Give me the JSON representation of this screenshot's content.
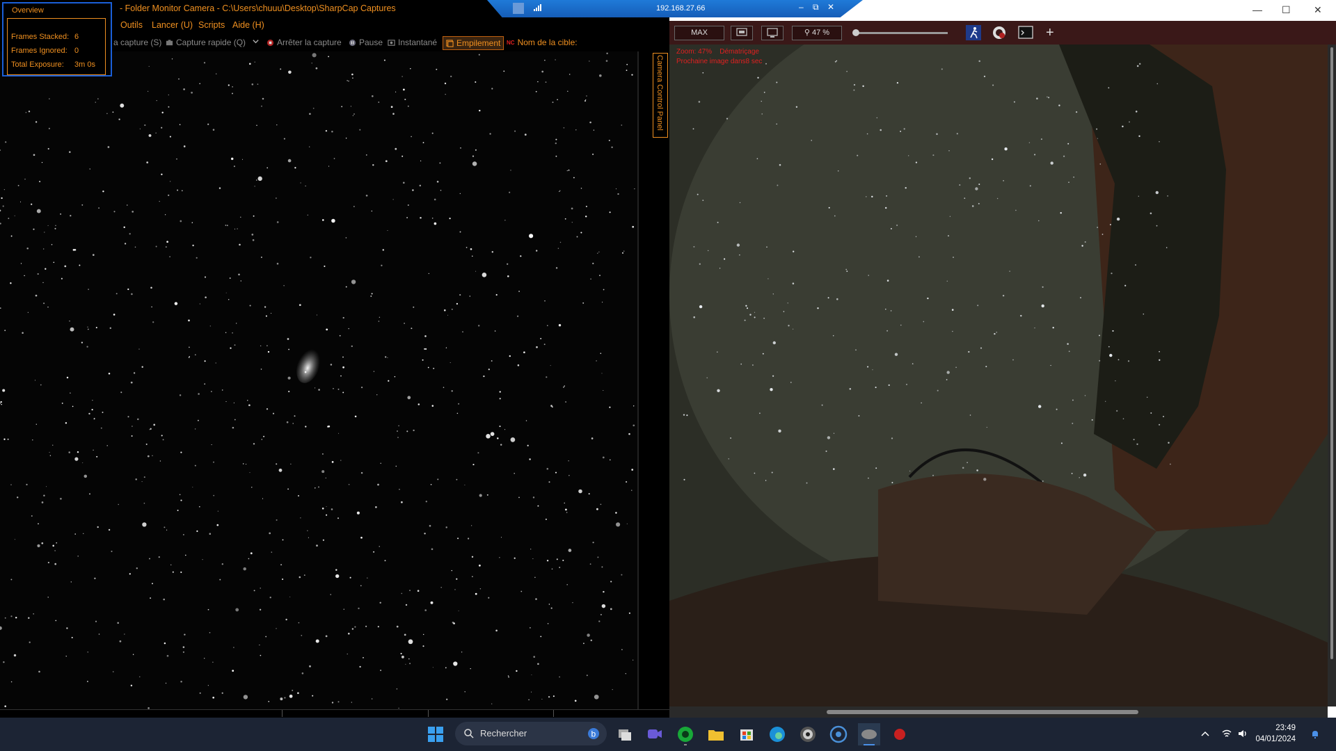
{
  "sharpcap": {
    "window_title": "- Folder Monitor Camera - C:\\Users\\chuuu\\Desktop\\SharpCap Captures",
    "menu": [
      {
        "label": "Outils"
      },
      {
        "label": "Lancer (U)"
      },
      {
        "label": "Scripts"
      },
      {
        "label": "Aide (H)"
      }
    ],
    "toolbar": {
      "start_capture": "a capture (S)",
      "quick_capture": "Capture rapide (Q)",
      "stop_capture": "Arrêter la capture",
      "pause": "Pause",
      "snapshot": "Instantané",
      "stacking": "Empilement",
      "target_prefix": "NC",
      "target_label": "Nom de la cible:"
    },
    "side_panel_tab": "Camera Control Panel",
    "overview": {
      "heading": "Overview",
      "frames_stacked_label": "Frames Stacked:",
      "frames_stacked": "6",
      "frames_ignored_label": "Frames Ignored:",
      "frames_ignored": "0",
      "total_exposure_label": "Total Exposure:",
      "total_exposure": "3m 0s"
    },
    "colors": {
      "accent": "#f09020",
      "overview_border": "#1a5fd8"
    }
  },
  "remote": {
    "ip": "192.168.27.66"
  },
  "ipcam": {
    "max_label": "MAX",
    "zoom_label": "47 %",
    "zoom_level": 0.0,
    "overlay_zoom": "Zoom: 47%",
    "overlay_demosaic": "Dématriçage",
    "overlay_next": "Prochaine image dans8 sec",
    "icons": [
      "fit-screen-icon",
      "monitor-icon",
      "magnifier-icon",
      "runner-icon",
      "timer-camera-icon",
      "terminal-icon",
      "plus-icon"
    ],
    "colors": {
      "toolbar": "#3a1818",
      "overlay_text": "#e02020"
    }
  },
  "taskbar": {
    "search_placeholder": "Rechercher",
    "time": "23:49",
    "date": "04/01/2024",
    "apps": [
      "task-view-icon",
      "meet-icon",
      "green-app-icon",
      "file-explorer-icon",
      "store-icon",
      "edge-icon",
      "dark-app-icon",
      "remote-app-icon",
      "sharpcap-icon",
      "red-app-icon"
    ]
  }
}
